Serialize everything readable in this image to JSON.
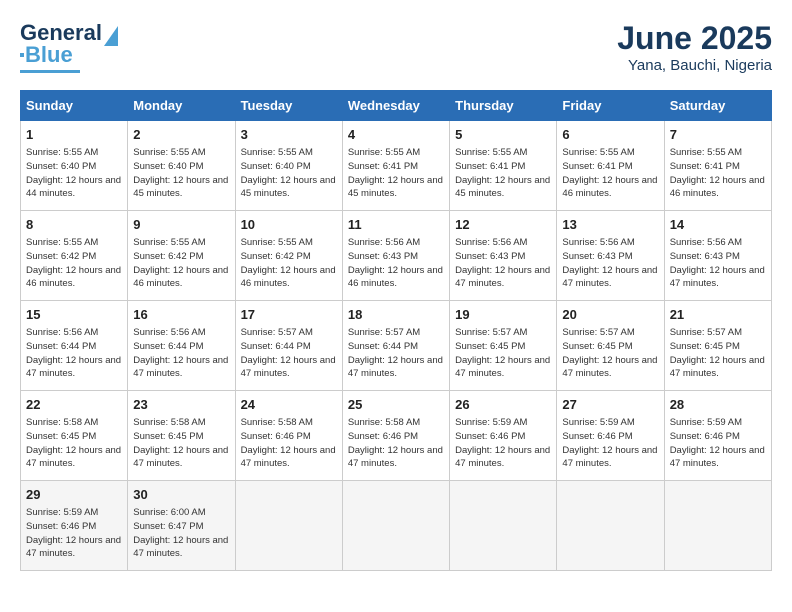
{
  "header": {
    "logo_line1": "General",
    "logo_line2": "Blue",
    "title": "June 2025",
    "subtitle": "Yana, Bauchi, Nigeria"
  },
  "calendar": {
    "columns": [
      "Sunday",
      "Monday",
      "Tuesday",
      "Wednesday",
      "Thursday",
      "Friday",
      "Saturday"
    ],
    "rows": [
      [
        {
          "day": "1",
          "info": "Sunrise: 5:55 AM\nSunset: 6:40 PM\nDaylight: 12 hours and 44 minutes."
        },
        {
          "day": "2",
          "info": "Sunrise: 5:55 AM\nSunset: 6:40 PM\nDaylight: 12 hours and 45 minutes."
        },
        {
          "day": "3",
          "info": "Sunrise: 5:55 AM\nSunset: 6:40 PM\nDaylight: 12 hours and 45 minutes."
        },
        {
          "day": "4",
          "info": "Sunrise: 5:55 AM\nSunset: 6:41 PM\nDaylight: 12 hours and 45 minutes."
        },
        {
          "day": "5",
          "info": "Sunrise: 5:55 AM\nSunset: 6:41 PM\nDaylight: 12 hours and 45 minutes."
        },
        {
          "day": "6",
          "info": "Sunrise: 5:55 AM\nSunset: 6:41 PM\nDaylight: 12 hours and 46 minutes."
        },
        {
          "day": "7",
          "info": "Sunrise: 5:55 AM\nSunset: 6:41 PM\nDaylight: 12 hours and 46 minutes."
        }
      ],
      [
        {
          "day": "8",
          "info": "Sunrise: 5:55 AM\nSunset: 6:42 PM\nDaylight: 12 hours and 46 minutes."
        },
        {
          "day": "9",
          "info": "Sunrise: 5:55 AM\nSunset: 6:42 PM\nDaylight: 12 hours and 46 minutes."
        },
        {
          "day": "10",
          "info": "Sunrise: 5:55 AM\nSunset: 6:42 PM\nDaylight: 12 hours and 46 minutes."
        },
        {
          "day": "11",
          "info": "Sunrise: 5:56 AM\nSunset: 6:43 PM\nDaylight: 12 hours and 46 minutes."
        },
        {
          "day": "12",
          "info": "Sunrise: 5:56 AM\nSunset: 6:43 PM\nDaylight: 12 hours and 47 minutes."
        },
        {
          "day": "13",
          "info": "Sunrise: 5:56 AM\nSunset: 6:43 PM\nDaylight: 12 hours and 47 minutes."
        },
        {
          "day": "14",
          "info": "Sunrise: 5:56 AM\nSunset: 6:43 PM\nDaylight: 12 hours and 47 minutes."
        }
      ],
      [
        {
          "day": "15",
          "info": "Sunrise: 5:56 AM\nSunset: 6:44 PM\nDaylight: 12 hours and 47 minutes."
        },
        {
          "day": "16",
          "info": "Sunrise: 5:56 AM\nSunset: 6:44 PM\nDaylight: 12 hours and 47 minutes."
        },
        {
          "day": "17",
          "info": "Sunrise: 5:57 AM\nSunset: 6:44 PM\nDaylight: 12 hours and 47 minutes."
        },
        {
          "day": "18",
          "info": "Sunrise: 5:57 AM\nSunset: 6:44 PM\nDaylight: 12 hours and 47 minutes."
        },
        {
          "day": "19",
          "info": "Sunrise: 5:57 AM\nSunset: 6:45 PM\nDaylight: 12 hours and 47 minutes."
        },
        {
          "day": "20",
          "info": "Sunrise: 5:57 AM\nSunset: 6:45 PM\nDaylight: 12 hours and 47 minutes."
        },
        {
          "day": "21",
          "info": "Sunrise: 5:57 AM\nSunset: 6:45 PM\nDaylight: 12 hours and 47 minutes."
        }
      ],
      [
        {
          "day": "22",
          "info": "Sunrise: 5:58 AM\nSunset: 6:45 PM\nDaylight: 12 hours and 47 minutes."
        },
        {
          "day": "23",
          "info": "Sunrise: 5:58 AM\nSunset: 6:45 PM\nDaylight: 12 hours and 47 minutes."
        },
        {
          "day": "24",
          "info": "Sunrise: 5:58 AM\nSunset: 6:46 PM\nDaylight: 12 hours and 47 minutes."
        },
        {
          "day": "25",
          "info": "Sunrise: 5:58 AM\nSunset: 6:46 PM\nDaylight: 12 hours and 47 minutes."
        },
        {
          "day": "26",
          "info": "Sunrise: 5:59 AM\nSunset: 6:46 PM\nDaylight: 12 hours and 47 minutes."
        },
        {
          "day": "27",
          "info": "Sunrise: 5:59 AM\nSunset: 6:46 PM\nDaylight: 12 hours and 47 minutes."
        },
        {
          "day": "28",
          "info": "Sunrise: 5:59 AM\nSunset: 6:46 PM\nDaylight: 12 hours and 47 minutes."
        }
      ],
      [
        {
          "day": "29",
          "info": "Sunrise: 5:59 AM\nSunset: 6:46 PM\nDaylight: 12 hours and 47 minutes."
        },
        {
          "day": "30",
          "info": "Sunrise: 6:00 AM\nSunset: 6:47 PM\nDaylight: 12 hours and 47 minutes."
        },
        {
          "day": "",
          "info": ""
        },
        {
          "day": "",
          "info": ""
        },
        {
          "day": "",
          "info": ""
        },
        {
          "day": "",
          "info": ""
        },
        {
          "day": "",
          "info": ""
        }
      ]
    ]
  }
}
